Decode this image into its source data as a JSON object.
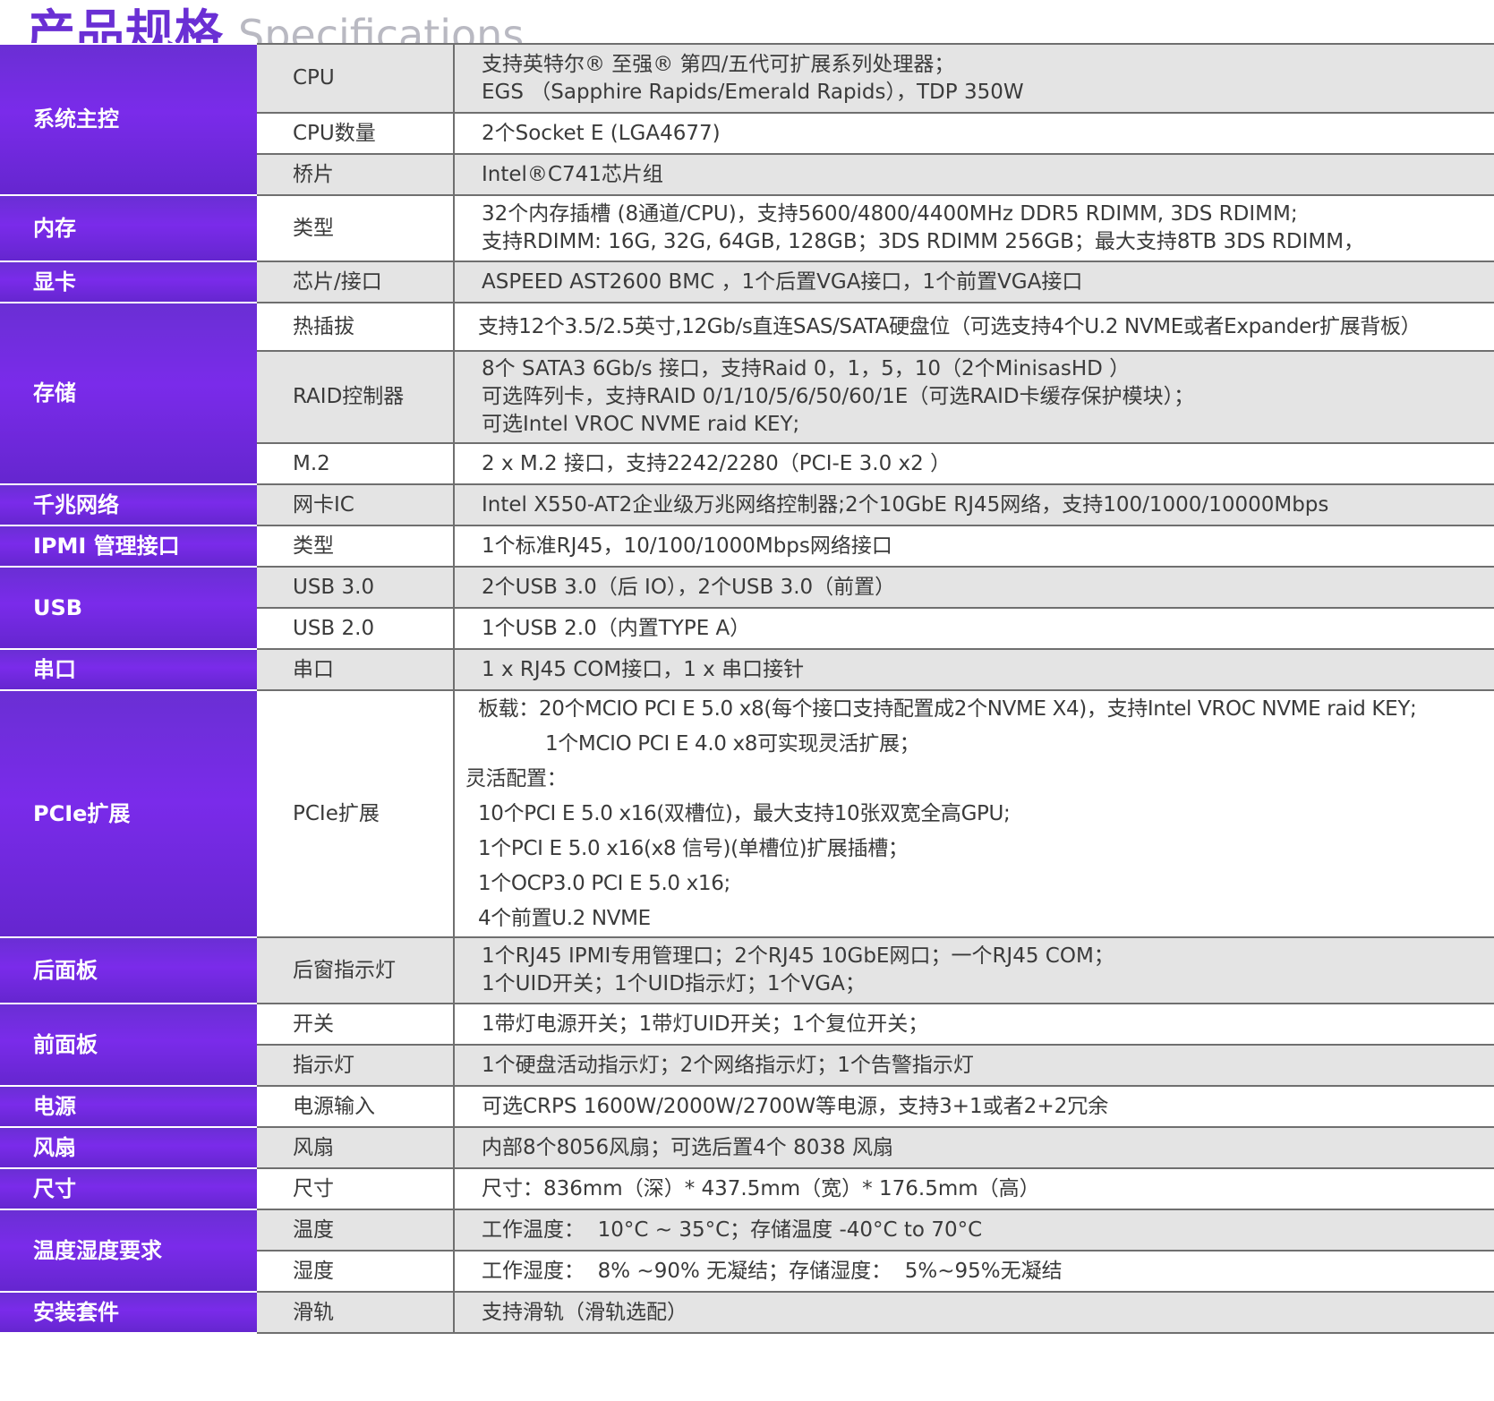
{
  "title": {
    "zh": "产品规格",
    "en": "Specifications"
  },
  "rows": [
    {
      "category": "系统主控",
      "sub": "CPU",
      "lines": [
        "支持英特尔® 至强® 第四/五代可扩展系列处理器；",
        "EGS （Sapphire Rapids/Emerald Rapids），TDP 350W"
      ]
    },
    {
      "sub": "CPU数量",
      "lines": [
        "2个Socket E (LGA4677)"
      ]
    },
    {
      "sub": "桥片",
      "lines": [
        "Intel®C741芯片组"
      ]
    },
    {
      "category": "内存",
      "sub": "类型",
      "lines": [
        "32个内存插槽 (8通道/CPU)，支持5600/4800/4400MHz DDR5 RDIMM, 3DS RDIMM;",
        "支持RDIMM: 16G, 32G, 64GB, 128GB；3DS RDIMM 256GB；最大支持8TB 3DS RDIMM，"
      ]
    },
    {
      "category": "显卡",
      "sub": "芯片/接口",
      "lines": [
        "ASPEED AST2600 BMC ，1个后置VGA接口，1个前置VGA接口"
      ]
    },
    {
      "category": "存储",
      "sub": "热插拔",
      "lines": [
        "支持12个3.5/2.5英寸,12Gb/s直连SAS/SATA硬盘位（可选支持4个U.2 NVME或者Expander扩展背板）"
      ]
    },
    {
      "sub": "RAID控制器",
      "lines": [
        "8个 SATA3 6Gb/s 接口，支持Raid 0，1，5，10（2个MinisasHD ）",
        "可选阵列卡，支持RAID 0/1/10/5/6/50/60/1E（可选RAID卡缓存保护模块）；",
        "可选Intel VROC NVME raid KEY;"
      ]
    },
    {
      "sub": "M.2",
      "lines": [
        "2 x M.2 接口，支持2242/2280（PCI-E 3.0 x2 ）"
      ]
    },
    {
      "category": "千兆网络",
      "sub": "网卡IC",
      "lines": [
        "Intel X550-AT2企业级万兆网络控制器;2个10GbE RJ45网络，支持100/1000/10000Mbps"
      ]
    },
    {
      "category": "IPMI 管理接口",
      "sub": "类型",
      "lines": [
        "1个标准RJ45，10/100/1000Mbps网络接口"
      ]
    },
    {
      "category": "USB",
      "sub": "USB 3.0",
      "lines": [
        "2个USB 3.0（后 IO），2个USB 3.0（前置）"
      ]
    },
    {
      "sub": "USB 2.0",
      "lines": [
        "1个USB 2.0（内置TYPE A）"
      ]
    },
    {
      "category": "串口",
      "sub": "串口",
      "lines": [
        "1 x RJ45 COM接口，1 x 串口接针"
      ]
    },
    {
      "category": "PCIe扩展",
      "sub": "PCIe扩展",
      "lines": [
        "板载：20个MCIO PCI E 5.0 x8(每个接口支持配置成2个NVME X4)，支持Intel VROC NVME raid KEY;",
        "1个MCIO PCI E 4.0 x8可实现灵活扩展；",
        "灵活配置：",
        "10个PCI E 5.0 x16(双槽位)，最大支持10张双宽全高GPU;",
        "1个PCI E 5.0 x16(x8 信号)(单槽位)扩展插槽；",
        "1个OCP3.0 PCI E 5.0 x16;",
        "4个前置U.2 NVME"
      ]
    },
    {
      "category": "后面板",
      "sub": "后窗指示灯",
      "lines": [
        "1个RJ45 IPMI专用管理口；2个RJ45 10GbE网口；一个RJ45 COM；",
        "1个UID开关；1个UID指示灯；1个VGA；"
      ]
    },
    {
      "category": "前面板",
      "sub": "开关",
      "lines": [
        "1带灯电源开关；1带灯UID开关；1个复位开关；"
      ]
    },
    {
      "sub": "指示灯",
      "lines": [
        "1个硬盘活动指示灯；2个网络指示灯；1个告警指示灯"
      ]
    },
    {
      "category": "电源",
      "sub": "电源输入",
      "lines": [
        "可选CRPS 1600W/2000W/2700W等电源，支持3+1或者2+2冗余"
      ]
    },
    {
      "category": "风扇",
      "sub": "风扇",
      "lines": [
        "内部8个8056风扇；可选后置4个 8038 风扇"
      ]
    },
    {
      "category": "尺寸",
      "sub": "尺寸",
      "lines": [
        "尺寸：836mm（深）* 437.5mm（宽）* 176.5mm（高）"
      ]
    },
    {
      "category": "温度湿度要求",
      "sub": "温度",
      "lines": [
        "工作温度：  10°C ~ 35°C；存储温度 -40°C to 70°C"
      ]
    },
    {
      "sub": "湿度",
      "lines": [
        "工作湿度：  8% ~90% 无凝结；存储湿度：  5%~95%无凝结"
      ]
    },
    {
      "category": "安装套件",
      "sub": "滑轨",
      "lines": [
        "支持滑轨（滑轨选配）"
      ]
    }
  ]
}
